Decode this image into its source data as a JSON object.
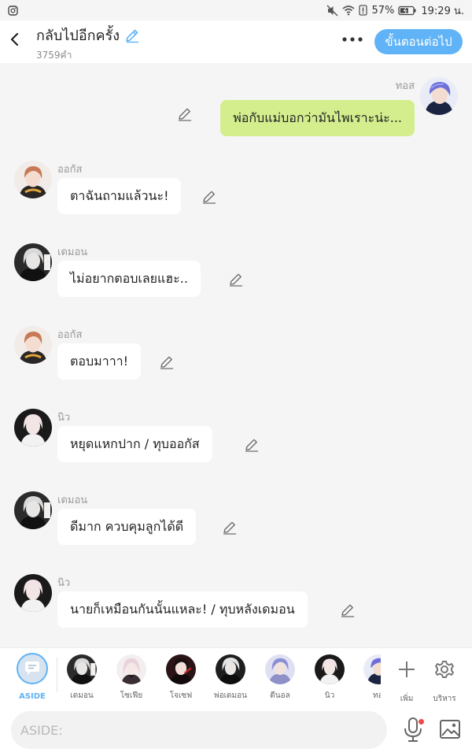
{
  "status_bar": {
    "left_icon": "instagram-icon",
    "battery_percent": "57%",
    "time": "19:29 น."
  },
  "header": {
    "title": "กลับไปอีกครั้ง",
    "word_count": "3759คำ",
    "next_button": "ขั้นตอนต่อไป"
  },
  "messages": [
    {
      "side": "right",
      "name": "ทอส",
      "text": "พ่อกับแม่บอกว่ามันไพเราะน่ะ..."
    },
    {
      "side": "left",
      "name": "ออกัส",
      "text": "ตาฉันถามแล้วนะ!"
    },
    {
      "side": "left",
      "name": "เดมอน",
      "text": "ไม่อยากตอบเลยแฮะ.."
    },
    {
      "side": "left",
      "name": "ออกัส",
      "text": "ตอบมาาา!"
    },
    {
      "side": "left",
      "name": "นิว",
      "text": "หยุดแหกปาก / ทุบออกัส"
    },
    {
      "side": "left",
      "name": "เดมอน",
      "text": "ดีมาก ควบคุมลูกได้ดี"
    },
    {
      "side": "left",
      "name": "นิว",
      "text": "นายก็เหมือนกันนั้นแหละ! / ทุบหลังเดมอน"
    }
  ],
  "character_bar": {
    "aside_label": "ASIDE",
    "characters": [
      {
        "label": "เดมอน"
      },
      {
        "label": "โซเฟีย"
      },
      {
        "label": "โจเซฟ"
      },
      {
        "label": "พ่อเดมอน"
      },
      {
        "label": "ดีนอล"
      },
      {
        "label": "นิว"
      },
      {
        "label": "ทอ"
      }
    ],
    "add_label": "เพิ่ม",
    "manage_label": "บริหาร"
  },
  "input": {
    "placeholder": "ASIDE:"
  },
  "colors": {
    "accent": "#5fb3f6",
    "own_bubble": "#d4ee8e",
    "other_bubble": "#ffffff",
    "background": "#f5f5f6",
    "notification_dot": "#f04848"
  }
}
